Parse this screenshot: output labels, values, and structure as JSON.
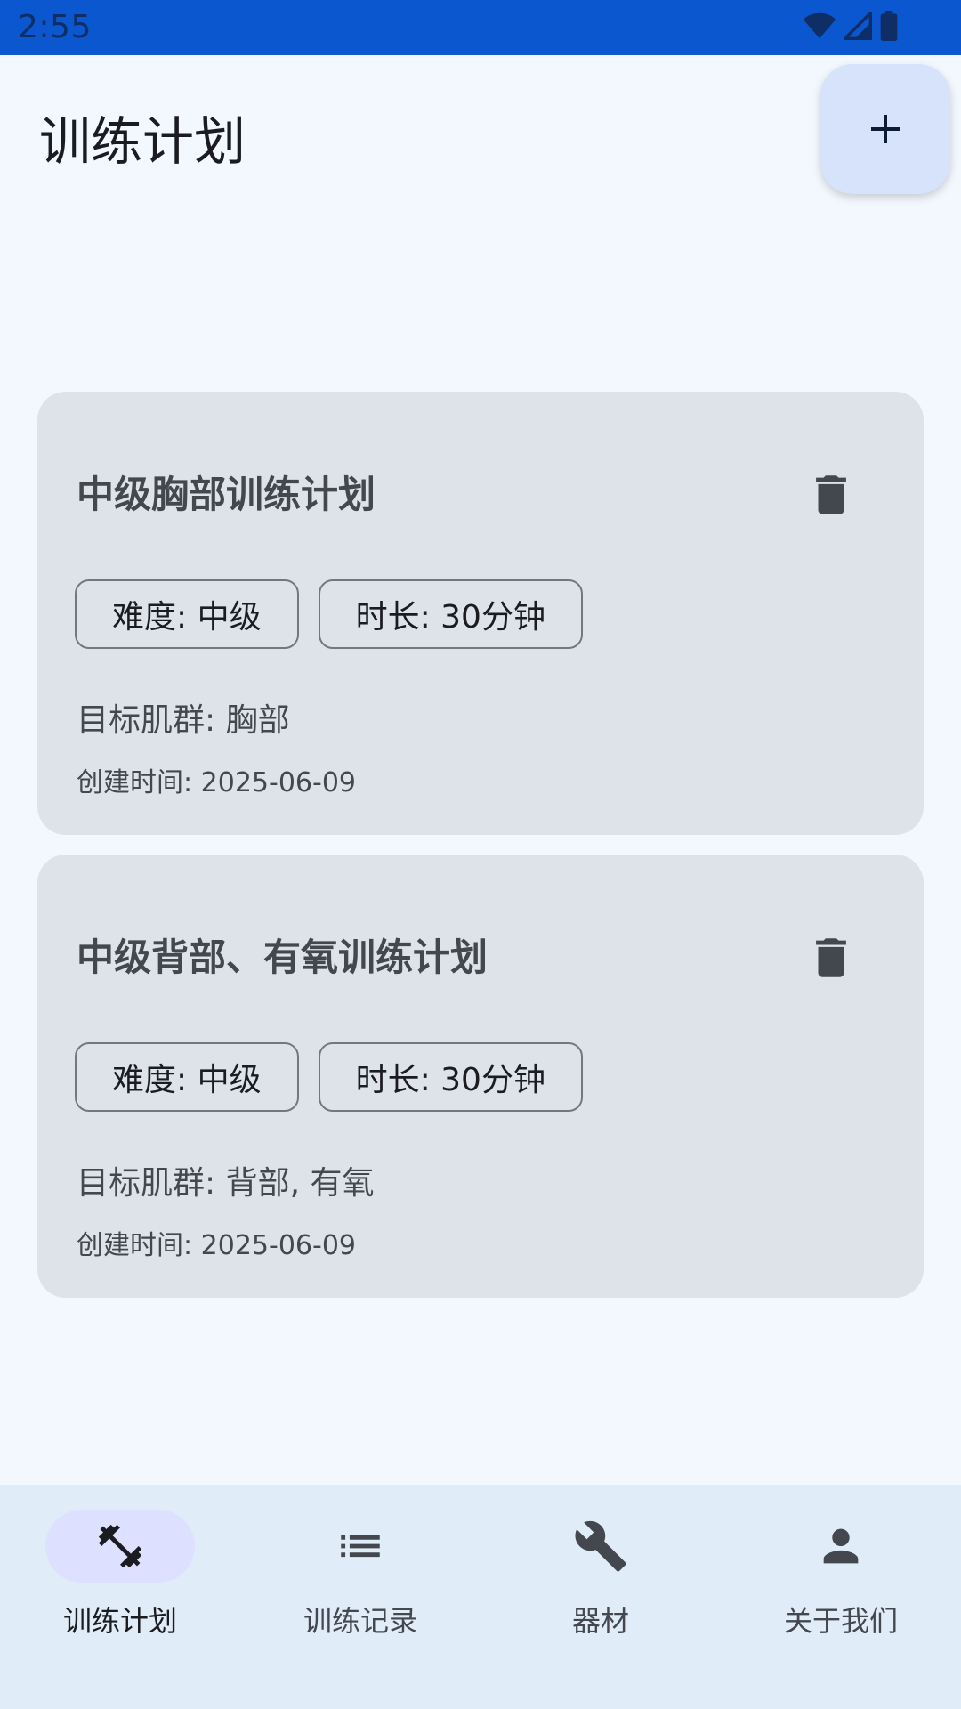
{
  "status_bar": {
    "time": "2:55"
  },
  "header": {
    "title": "训练计划"
  },
  "plans": [
    {
      "title": "中级胸部训练计划",
      "difficulty": "难度: 中级",
      "duration": "时长: 30分钟",
      "target": "目标肌群: 胸部",
      "created": "创建时间: 2025-06-09"
    },
    {
      "title": "中级背部、有氧训练计划",
      "difficulty": "难度: 中级",
      "duration": "时长: 30分钟",
      "target": "目标肌群: 背部, 有氧",
      "created": "创建时间: 2025-06-09"
    }
  ],
  "bottom_nav": {
    "items": [
      {
        "label": "训练计划",
        "icon": "dumbbell-icon",
        "active": true
      },
      {
        "label": "训练记录",
        "icon": "list-icon",
        "active": false
      },
      {
        "label": "器材",
        "icon": "wrench-icon",
        "active": false
      },
      {
        "label": "关于我们",
        "icon": "person-icon",
        "active": false
      }
    ]
  },
  "colors": {
    "status_bar": "#0b57cf",
    "background": "#f3f8ff",
    "card": "#dee3ea",
    "fab": "#d6e3fb",
    "nav_background": "#e1ecf9",
    "nav_active_indicator": "#dde1ff"
  }
}
